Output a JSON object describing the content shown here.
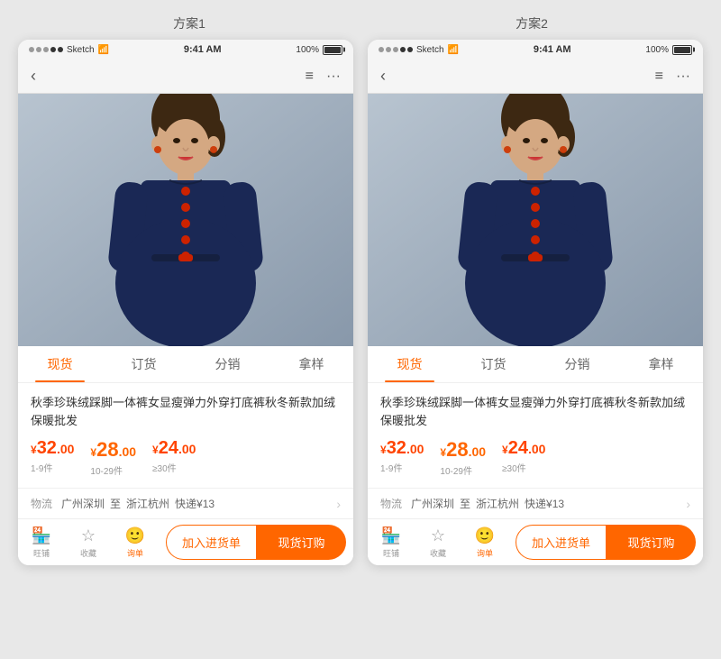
{
  "page": {
    "background_color": "#e8e8e8"
  },
  "scheme1": {
    "label": "方案1",
    "status_bar": {
      "dots": [
        false,
        false,
        false,
        true,
        true
      ],
      "app": "Sketch",
      "wifi": "▲",
      "time": "9:41 AM",
      "battery_pct": "100%"
    },
    "nav": {
      "back": "‹",
      "icon_doc": "≡",
      "icon_more": "···"
    },
    "tabs": [
      {
        "label": "现货",
        "active": true
      },
      {
        "label": "订货",
        "active": false
      },
      {
        "label": "分销",
        "active": false
      },
      {
        "label": "拿样",
        "active": false
      }
    ],
    "product_title": "秋季珍珠绒踩脚一体裤女显瘦弹力外穿打底裤秋冬新款加绒保暖批发",
    "prices": [
      {
        "symbol": "¥",
        "int": "32",
        "dec": ".00",
        "range": "1-9件"
      },
      {
        "symbol": "¥",
        "int": "28",
        "dec": ".00",
        "range": "10-29件"
      },
      {
        "symbol": "¥",
        "int": "24",
        "dec": ".00",
        "range": "≥30件"
      }
    ],
    "shipping": {
      "label": "物流",
      "from": "广州深圳",
      "connector": "至",
      "to": "浙江杭州",
      "express": "快递¥13"
    },
    "bottom": {
      "icons": [
        {
          "icon": "🏪",
          "label": "旺铺"
        },
        {
          "icon": "☆",
          "label": "收藏"
        },
        {
          "icon": "🙂",
          "label": "询单"
        }
      ],
      "btn_add": "加入进货单",
      "btn_buy": "现货订购"
    }
  },
  "scheme2": {
    "label": "方案2",
    "status_bar": {
      "dots": [
        false,
        false,
        false,
        true,
        true
      ],
      "app": "Sketch",
      "wifi": "▲",
      "time": "9:41 AM",
      "battery_pct": "100%"
    },
    "nav": {
      "back": "‹",
      "icon_doc": "≡",
      "icon_more": "···"
    },
    "tabs": [
      {
        "label": "现货",
        "active": true
      },
      {
        "label": "订货",
        "active": false
      },
      {
        "label": "分销",
        "active": false
      },
      {
        "label": "拿样",
        "active": false
      }
    ],
    "product_title": "秋季珍珠绒踩脚一体裤女显瘦弹力外穿打底裤秋冬新款加绒保暖批发",
    "prices": [
      {
        "symbol": "¥",
        "int": "32",
        "dec": ".00",
        "range": "1-9件"
      },
      {
        "symbol": "¥",
        "int": "28",
        "dec": ".00",
        "range": "10-29件"
      },
      {
        "symbol": "¥",
        "int": "24",
        "dec": ".00",
        "range": "≥30件"
      }
    ],
    "shipping": {
      "label": "物流",
      "from": "广州深圳",
      "connector": "至",
      "to": "浙江杭州",
      "express": "快递¥13"
    },
    "bottom": {
      "icons": [
        {
          "icon": "🏪",
          "label": "旺铺"
        },
        {
          "icon": "☆",
          "label": "收藏"
        },
        {
          "icon": "🙂",
          "label": "询单"
        }
      ],
      "btn_add": "加入进货单",
      "btn_buy": "现货订购"
    }
  }
}
